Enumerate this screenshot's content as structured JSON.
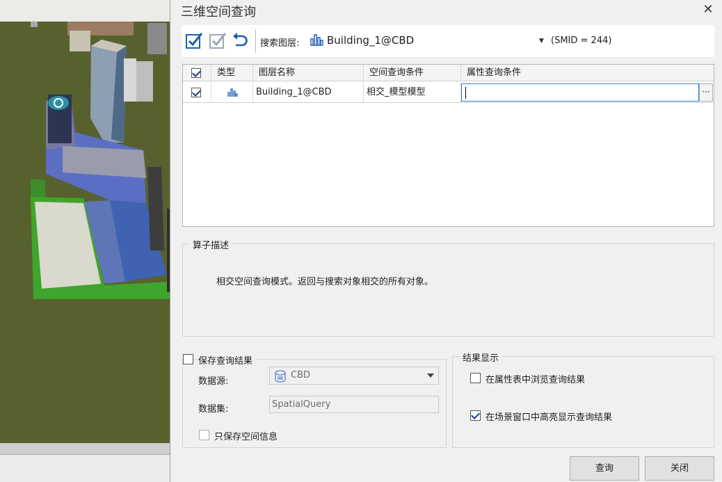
{
  "dialog": {
    "title": "三维空间查询",
    "close_glyph": "✕"
  },
  "toolbar": {
    "search_layer_label": "搜索图层:",
    "search_layer_value": "Building_1@CBD",
    "smid_text": "(SMID = 244)"
  },
  "grid": {
    "headers": [
      "类型",
      "图层名称",
      "空间查询条件",
      "属性查询条件"
    ],
    "rows": [
      {
        "checked": true,
        "type_icon": "building-layer-icon",
        "layer_name": "Building_1@CBD",
        "spatial_condition": "相交_模型模型",
        "attr_condition": ""
      }
    ],
    "ellipsis": "···"
  },
  "operator_desc": {
    "title": "算子描述",
    "text": "相交空间查询模式。返回与搜索对象相交的所有对象。"
  },
  "save_results": {
    "label": "保存查询结果",
    "checked": false,
    "datasource_label": "数据源:",
    "datasource_value": "CBD",
    "dataset_label": "数据集:",
    "dataset_value": "SpatialQuery",
    "spatial_only_label": "只保存空间信息"
  },
  "result_display": {
    "title": "结果显示",
    "browse_label": "在属性表中浏览查询结果",
    "browse_checked": false,
    "highlight_label": "在场景窗口中高亮显示查询结果",
    "highlight_checked": true
  },
  "buttons": {
    "query": "查询",
    "close": "关闭"
  },
  "colors": {
    "accent_blue": "#1a5fb4",
    "check_blue": "#1a3a8a",
    "scene_ground": "#57612d"
  }
}
